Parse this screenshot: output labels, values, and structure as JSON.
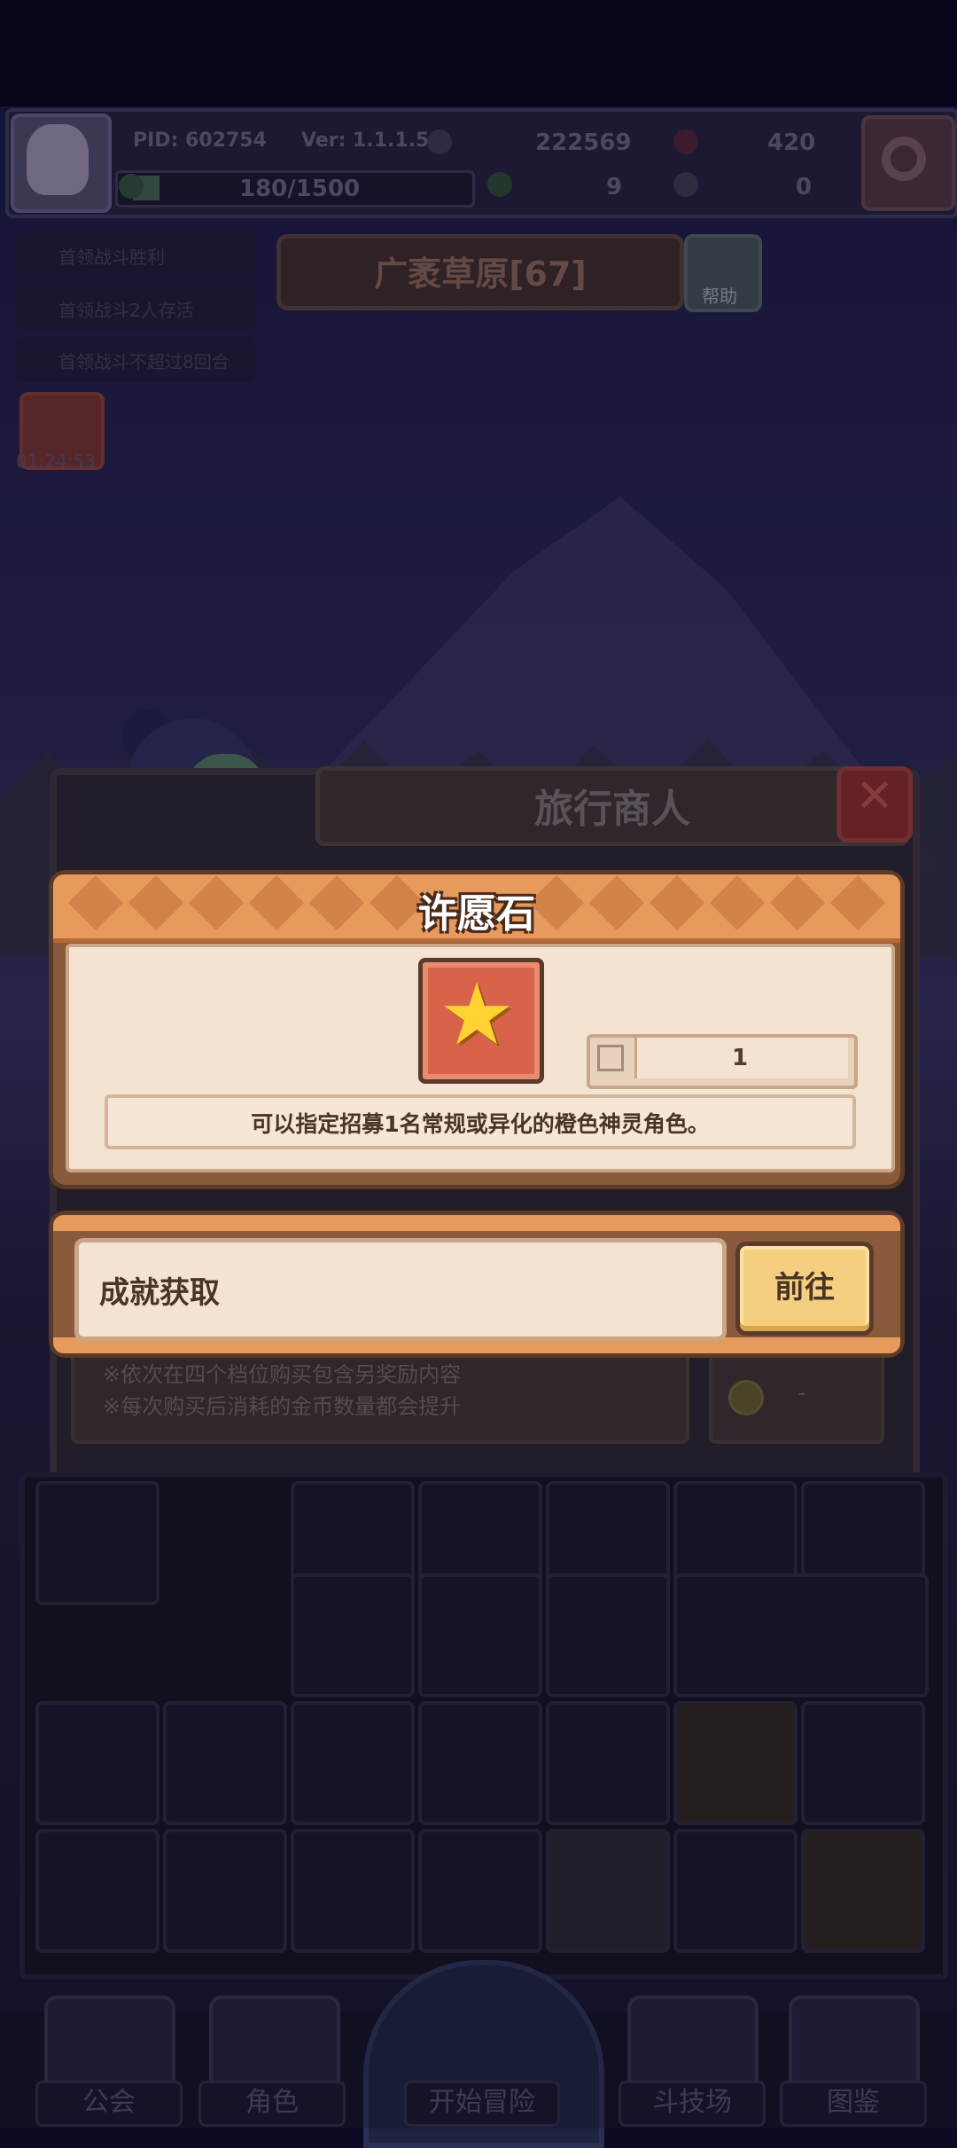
{
  "header": {
    "pid": "PID: 602754",
    "version": "Ver: 1.1.1.5",
    "gold": "222569",
    "gems": "420",
    "exp": "180/1500",
    "clover_count": "9",
    "key_count": "0"
  },
  "quests": [
    {
      "label": "首领战斗胜利"
    },
    {
      "label": "首领战斗2人存活"
    },
    {
      "label": "首领战斗不超过8回合"
    }
  ],
  "chest_timer": "01:24:53",
  "stage": {
    "title": "广袤草原[67]",
    "help_label": "帮助"
  },
  "merchant": {
    "title": "旅行商人",
    "notes": [
      "※依次在四个档位购买包含另奖励内容",
      "※每次购买后消耗的金币数量都会提升"
    ],
    "price": "-"
  },
  "item_dialog": {
    "title": "许愿石",
    "icon": "star-icon",
    "quantity": "1",
    "description": "可以指定招募1名常规或异化的橙色神灵角色。"
  },
  "source_dialog": {
    "source_label": "成就获取",
    "go_label": "前往"
  },
  "nav": {
    "guild": "公会",
    "character": "角色",
    "start": "开始冒险",
    "arena": "斗技场",
    "codex": "图鉴"
  },
  "colors": {
    "banner_orange": "#e69b5c",
    "dialog_cream": "#f4e3d1",
    "button_yellow": "#f4cf7f",
    "icon_red": "#d9634a"
  }
}
